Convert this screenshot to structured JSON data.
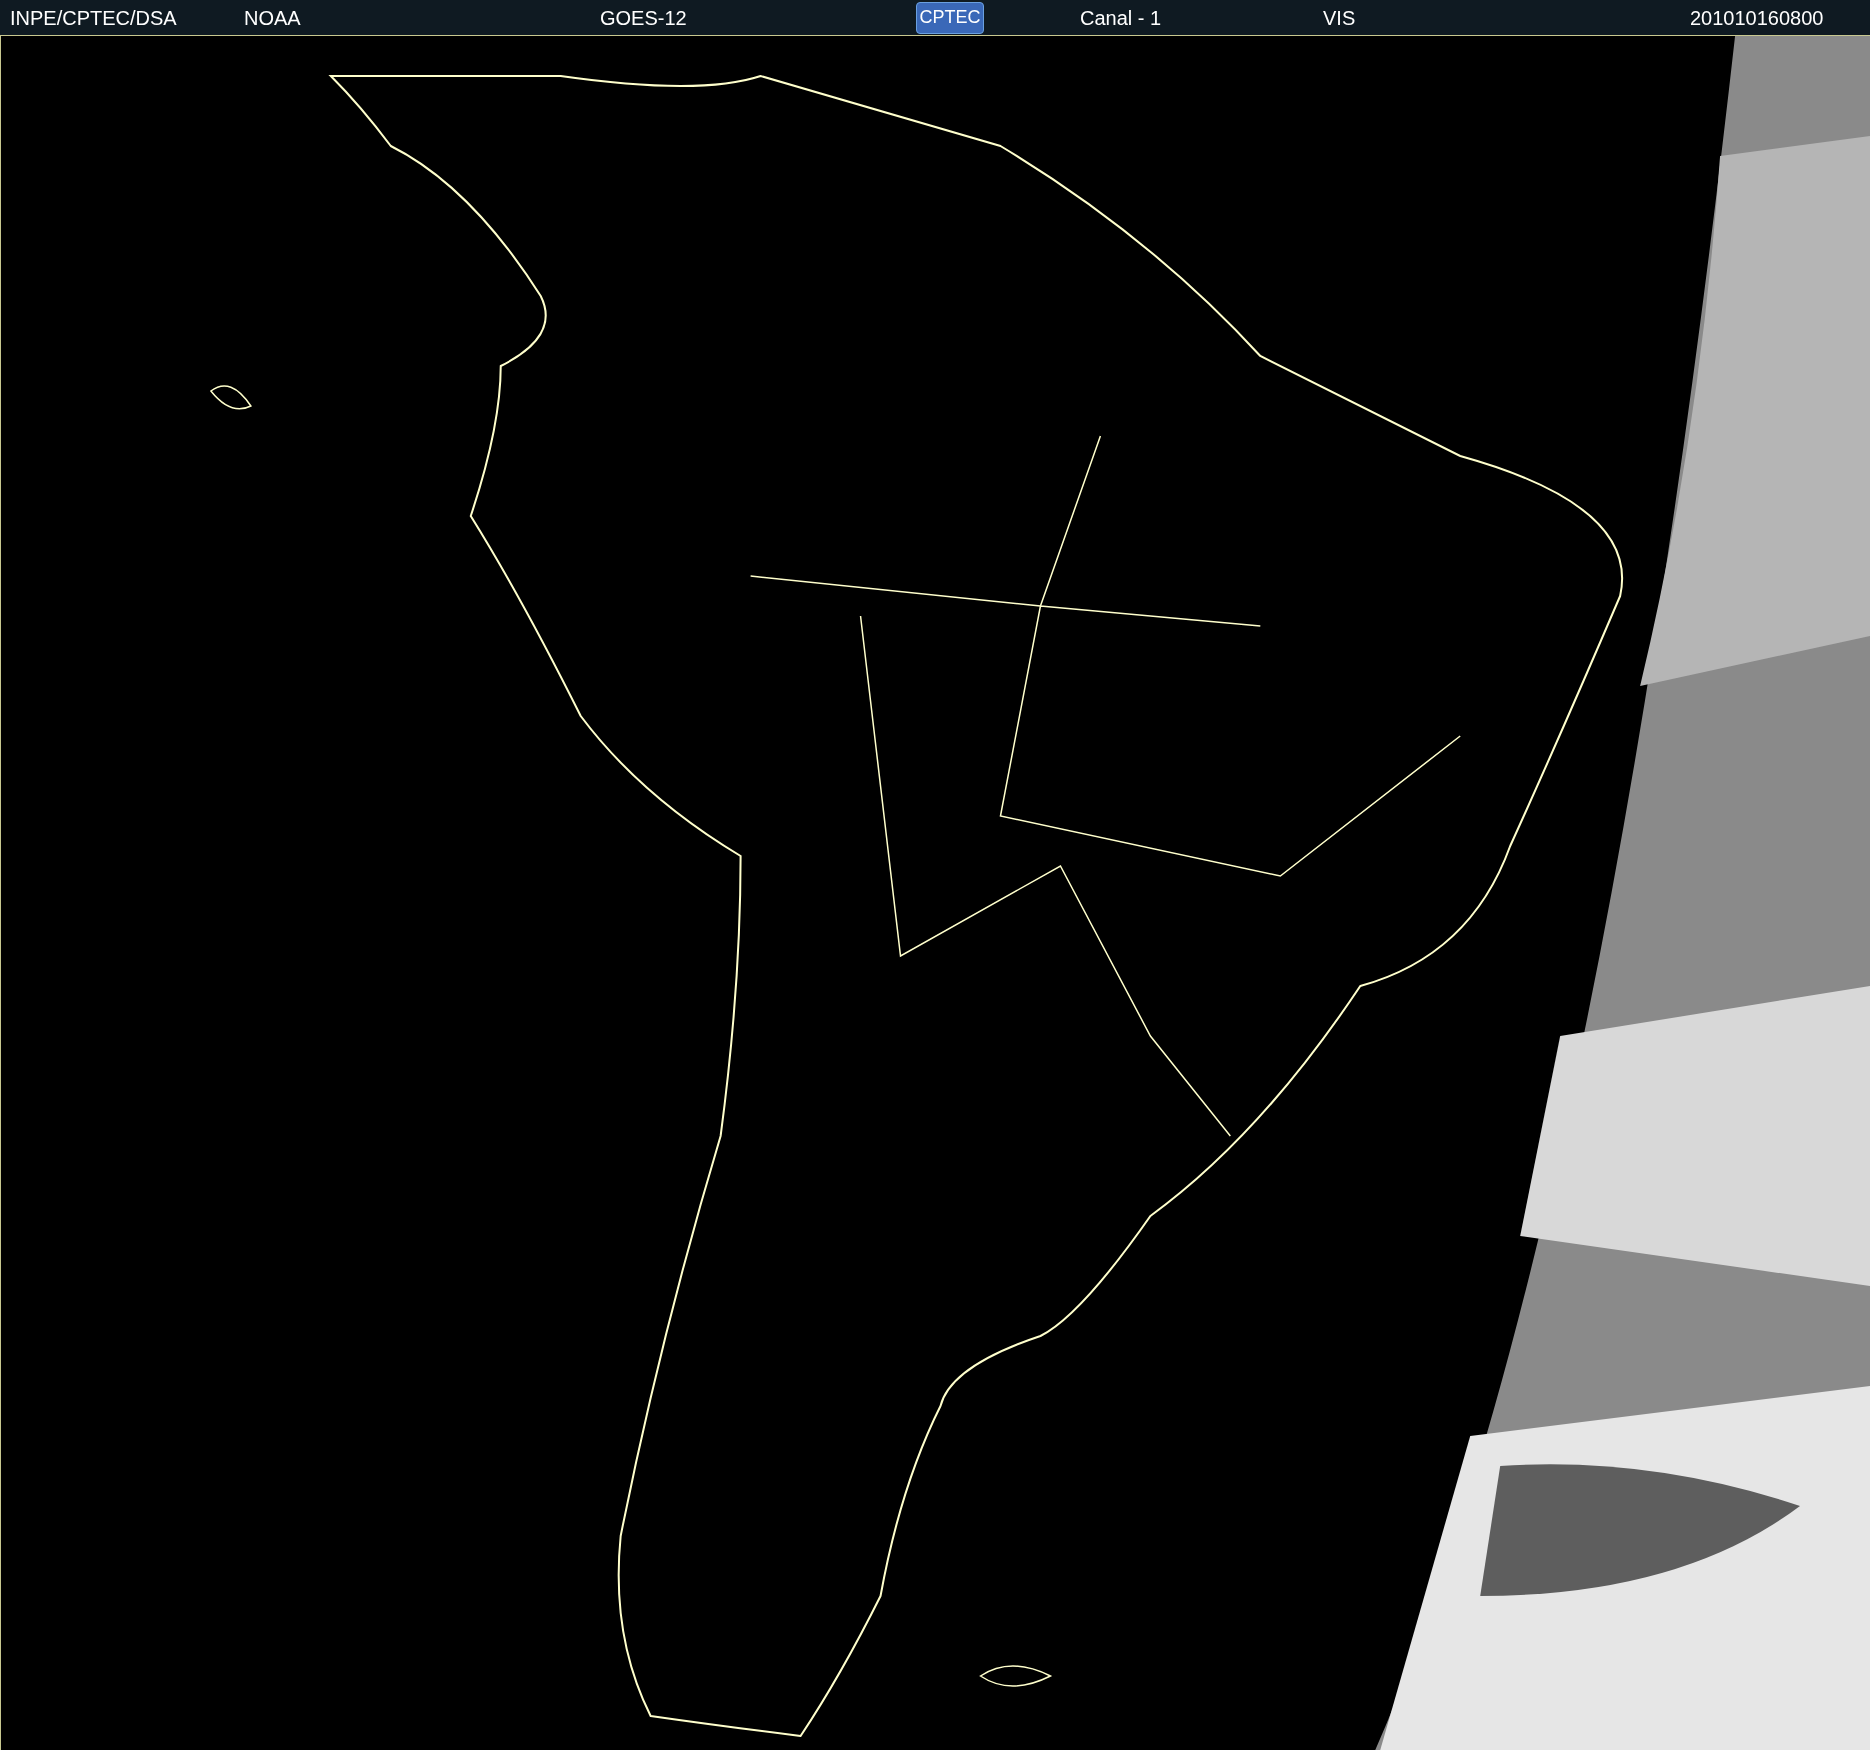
{
  "header": {
    "source": "INPE/CPTEC/DSA",
    "agency": "NOAA",
    "satellite": "GOES-12",
    "logo": "CPTEC",
    "channel": "Canal - 1",
    "band": "VIS",
    "timestamp": "201010160800"
  }
}
